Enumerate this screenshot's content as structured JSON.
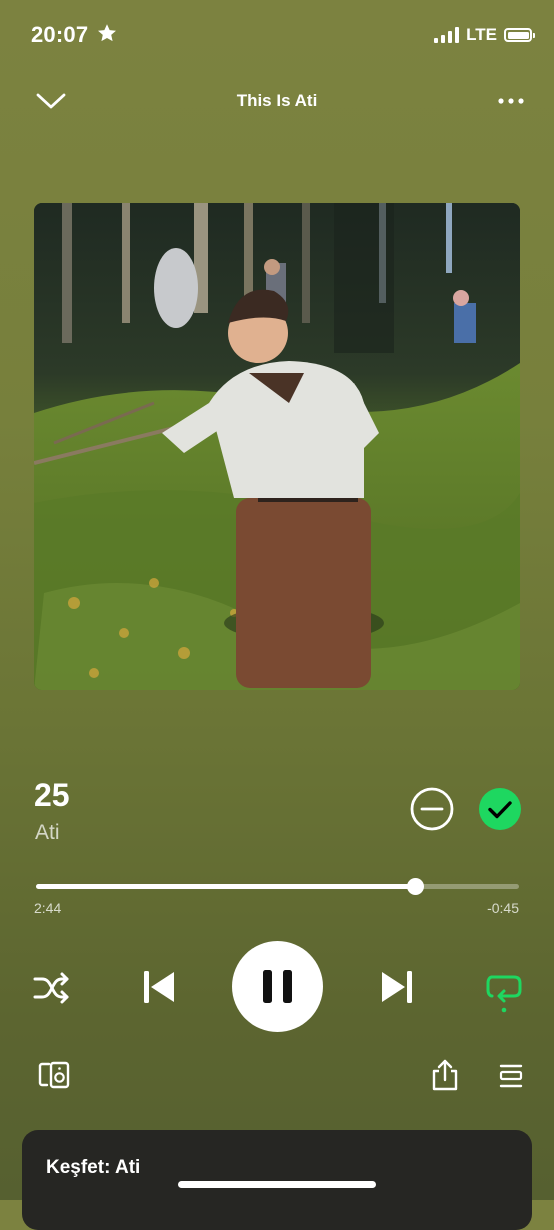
{
  "status_bar": {
    "time": "20:07",
    "network": "LTE",
    "star_icon": "star-icon",
    "battery_level": 1.0,
    "signal_bars": 4
  },
  "header": {
    "title": "This Is Ati",
    "left_icon": "chevron-down-icon",
    "right_icon": "more-icon"
  },
  "artwork": {
    "icon": "album-artwork"
  },
  "track": {
    "title": "25",
    "artist": "Ati",
    "remove_icon": "remove-icon",
    "saved_icon": "check-icon"
  },
  "playback": {
    "elapsed": "2:44",
    "remaining": "-0:45",
    "progress": 0.7847
  },
  "controls": {
    "shuffle_icon": "shuffle-icon",
    "previous_icon": "skip-previous-icon",
    "play_pause_icon": "pause-icon",
    "next_icon": "skip-next-icon",
    "repeat_icon": "repeat-icon"
  },
  "tools": {
    "devices_icon": "devices-icon",
    "share_icon": "share-icon",
    "queue_icon": "queue-icon"
  },
  "discover_card": {
    "title": "Keşfet: Ati"
  },
  "colors": {
    "background_top": "#7c8240",
    "background_bottom": "#566030",
    "accent_green": "#1ed760",
    "card_bg": "#262623"
  }
}
